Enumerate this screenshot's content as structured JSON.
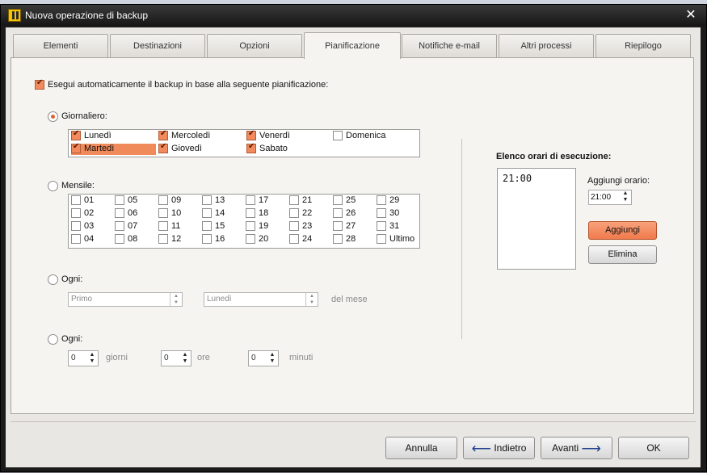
{
  "window": {
    "title": "Nuova operazione di backup",
    "close": "✕"
  },
  "tabs": [
    "Elementi",
    "Destinazioni",
    "Opzioni",
    "Pianificazione",
    "Notifiche e-mail",
    "Altri processi",
    "Riepilogo"
  ],
  "schedule": {
    "auto_label": "Esegui automaticamente il backup in base alla seguente pianificazione:",
    "daily_label": "Giornaliero:",
    "days": [
      {
        "label": "Lunedì",
        "checked": true
      },
      {
        "label": "Mercoledì",
        "checked": true
      },
      {
        "label": "Venerdì",
        "checked": true
      },
      {
        "label": "Domenica",
        "checked": false
      },
      {
        "label": "Martedì",
        "checked": true
      },
      {
        "label": "Giovedì",
        "checked": true
      },
      {
        "label": "Sabato",
        "checked": true
      }
    ],
    "monthly_label": "Mensile:",
    "month_days": [
      "01",
      "05",
      "09",
      "13",
      "17",
      "21",
      "25",
      "29",
      "02",
      "06",
      "10",
      "14",
      "18",
      "22",
      "26",
      "30",
      "03",
      "07",
      "11",
      "15",
      "19",
      "23",
      "27",
      "31",
      "04",
      "08",
      "12",
      "16",
      "20",
      "24",
      "28",
      "Ultimo"
    ],
    "every_label": "Ogni:",
    "every_first": "Primo",
    "every_day": "Lunedì",
    "of_month": "del mese",
    "every2_label": "Ogni:",
    "days_value": "0",
    "days_unit": "giorni",
    "hours_value": "0",
    "hours_unit": "ore",
    "minutes_value": "0",
    "minutes_unit": "minuti"
  },
  "times": {
    "title": "Elenco orari di esecuzione:",
    "list": [
      "21:00"
    ],
    "add_label": "Aggiungi orario:",
    "time_value": "21:00",
    "add_button": "Aggiungi",
    "remove_button": "Elimina"
  },
  "footer": {
    "cancel": "Annulla",
    "back": "Indietro",
    "next": "Avanti",
    "ok": "OK",
    "back_icon": "arrow-left-icon",
    "next_icon": "arrow-right-icon"
  },
  "colors": {
    "accent": "#f08a5a",
    "title_bar": "#1b1b1b"
  }
}
